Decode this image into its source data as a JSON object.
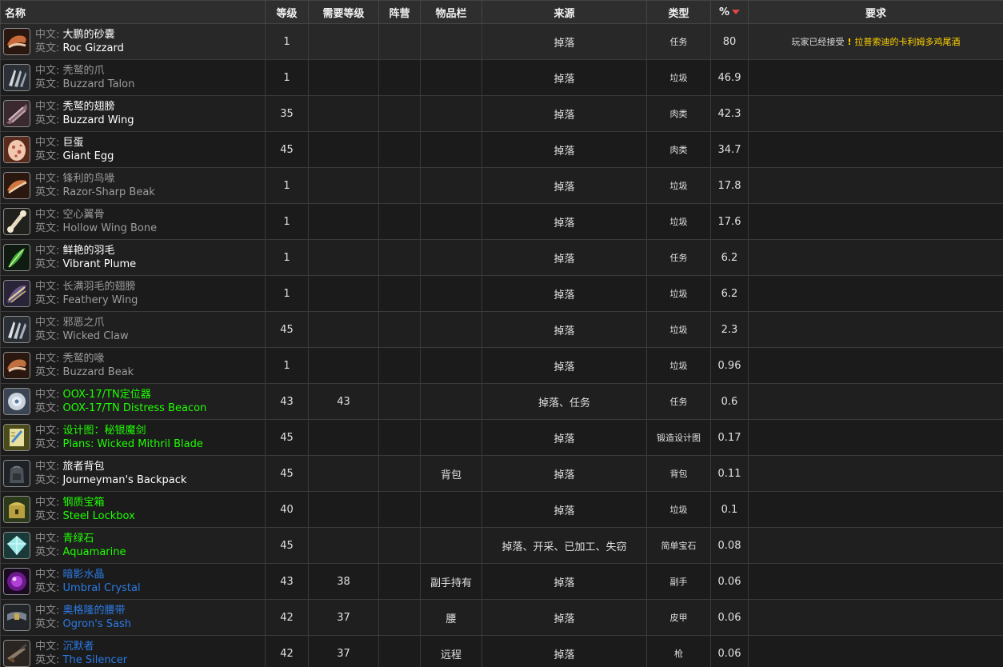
{
  "header": {
    "name": "名称",
    "level": "等级",
    "req_level": "需要等级",
    "faction": "阵营",
    "slot": "物品栏",
    "source": "来源",
    "type": "类型",
    "percent": "%",
    "requirement": "要求"
  },
  "labels": {
    "cn": "中文:",
    "en": "英文:"
  },
  "colors": {
    "white": "#ffffff",
    "gray": "#9d9d9d",
    "green": "#1eff00",
    "blue": "#2c7be5",
    "quest": "#ffd100",
    "sort_arrow": "#e04646"
  },
  "rows": [
    {
      "icon": "roc-gizzard-icon",
      "cn": "大鹏的砂囊",
      "en": "Roc Gizzard",
      "quality": "white",
      "level": "1",
      "req_level": "",
      "faction": "",
      "slot": "",
      "source": "掉落",
      "type": "任务",
      "percent": "80",
      "requirement": {
        "text": "玩家已经接受",
        "icon": "exclamation-icon",
        "quest": "拉普索迪的卡利姆多鸡尾酒"
      }
    },
    {
      "icon": "buzzard-talon-icon",
      "cn": "秃鹫的爪",
      "en": "Buzzard Talon",
      "quality": "gray",
      "level": "1",
      "req_level": "",
      "faction": "",
      "slot": "",
      "source": "掉落",
      "type": "垃圾",
      "percent": "46.9"
    },
    {
      "icon": "buzzard-wing-icon",
      "cn": "秃鹫的翅膀",
      "en": "Buzzard Wing",
      "quality": "white",
      "level": "35",
      "req_level": "",
      "faction": "",
      "slot": "",
      "source": "掉落",
      "type": "肉类",
      "percent": "42.3"
    },
    {
      "icon": "giant-egg-icon",
      "cn": "巨蛋",
      "en": "Giant Egg",
      "quality": "white",
      "level": "45",
      "req_level": "",
      "faction": "",
      "slot": "",
      "source": "掉落",
      "type": "肉类",
      "percent": "34.7"
    },
    {
      "icon": "razor-sharp-beak-icon",
      "cn": "锋利的鸟喙",
      "en": "Razor-Sharp Beak",
      "quality": "gray",
      "level": "1",
      "req_level": "",
      "faction": "",
      "slot": "",
      "source": "掉落",
      "type": "垃圾",
      "percent": "17.8"
    },
    {
      "icon": "hollow-wing-bone-icon",
      "cn": "空心翼骨",
      "en": "Hollow Wing Bone",
      "quality": "gray",
      "level": "1",
      "req_level": "",
      "faction": "",
      "slot": "",
      "source": "掉落",
      "type": "垃圾",
      "percent": "17.6"
    },
    {
      "icon": "vibrant-plume-icon",
      "cn": "鲜艳的羽毛",
      "en": "Vibrant Plume",
      "quality": "white",
      "level": "1",
      "req_level": "",
      "faction": "",
      "slot": "",
      "source": "掉落",
      "type": "任务",
      "percent": "6.2"
    },
    {
      "icon": "feathery-wing-icon",
      "cn": "长满羽毛的翅膀",
      "en": "Feathery Wing",
      "quality": "gray",
      "level": "1",
      "req_level": "",
      "faction": "",
      "slot": "",
      "source": "掉落",
      "type": "垃圾",
      "percent": "6.2"
    },
    {
      "icon": "wicked-claw-icon",
      "cn": "邪恶之爪",
      "en": "Wicked Claw",
      "quality": "gray",
      "level": "45",
      "req_level": "",
      "faction": "",
      "slot": "",
      "source": "掉落",
      "type": "垃圾",
      "percent": "2.3"
    },
    {
      "icon": "buzzard-beak-icon",
      "cn": "秃鹫的喙",
      "en": "Buzzard Beak",
      "quality": "gray",
      "level": "1",
      "req_level": "",
      "faction": "",
      "slot": "",
      "source": "掉落",
      "type": "垃圾",
      "percent": "0.96"
    },
    {
      "icon": "distress-beacon-icon",
      "cn": "OOX-17/TN定位器",
      "en": "OOX-17/TN Distress Beacon",
      "quality": "green",
      "level": "43",
      "req_level": "43",
      "faction": "",
      "slot": "",
      "source": "掉落、任务",
      "type": "任务",
      "percent": "0.6"
    },
    {
      "icon": "plans-scroll-icon",
      "cn": "设计图：秘银魔剑",
      "en": "Plans: Wicked Mithril Blade",
      "quality": "green",
      "level": "45",
      "req_level": "",
      "faction": "",
      "slot": "",
      "source": "掉落",
      "type": "锻造设计图",
      "percent": "0.17"
    },
    {
      "icon": "backpack-icon",
      "cn": "旅者背包",
      "en": "Journeyman's Backpack",
      "quality": "white",
      "level": "45",
      "req_level": "",
      "faction": "",
      "slot": "背包",
      "source": "掉落",
      "type": "背包",
      "percent": "0.11"
    },
    {
      "icon": "lockbox-icon",
      "cn": "钢质宝箱",
      "en": "Steel Lockbox",
      "quality": "green",
      "level": "40",
      "req_level": "",
      "faction": "",
      "slot": "",
      "source": "掉落",
      "type": "垃圾",
      "percent": "0.1"
    },
    {
      "icon": "aquamarine-icon",
      "cn": "青绿石",
      "en": "Aquamarine",
      "quality": "green",
      "level": "45",
      "req_level": "",
      "faction": "",
      "slot": "",
      "source": "掉落、开采、已加工、失窃",
      "type": "简单宝石",
      "percent": "0.08"
    },
    {
      "icon": "umbral-crystal-icon",
      "cn": "暗影水晶",
      "en": "Umbral Crystal",
      "quality": "blue",
      "level": "43",
      "req_level": "38",
      "faction": "",
      "slot": "副手持有",
      "source": "掉落",
      "type": "副手",
      "percent": "0.06"
    },
    {
      "icon": "sash-icon",
      "cn": "奥格隆的腰带",
      "en": "Ogron's Sash",
      "quality": "blue",
      "level": "42",
      "req_level": "37",
      "faction": "",
      "slot": "腰",
      "source": "掉落",
      "type": "皮甲",
      "percent": "0.06"
    },
    {
      "icon": "gun-icon",
      "cn": "沉默者",
      "en": "The Silencer",
      "quality": "blue",
      "level": "42",
      "req_level": "37",
      "faction": "",
      "slot": "远程",
      "source": "掉落",
      "type": "枪",
      "percent": "0.06"
    }
  ]
}
